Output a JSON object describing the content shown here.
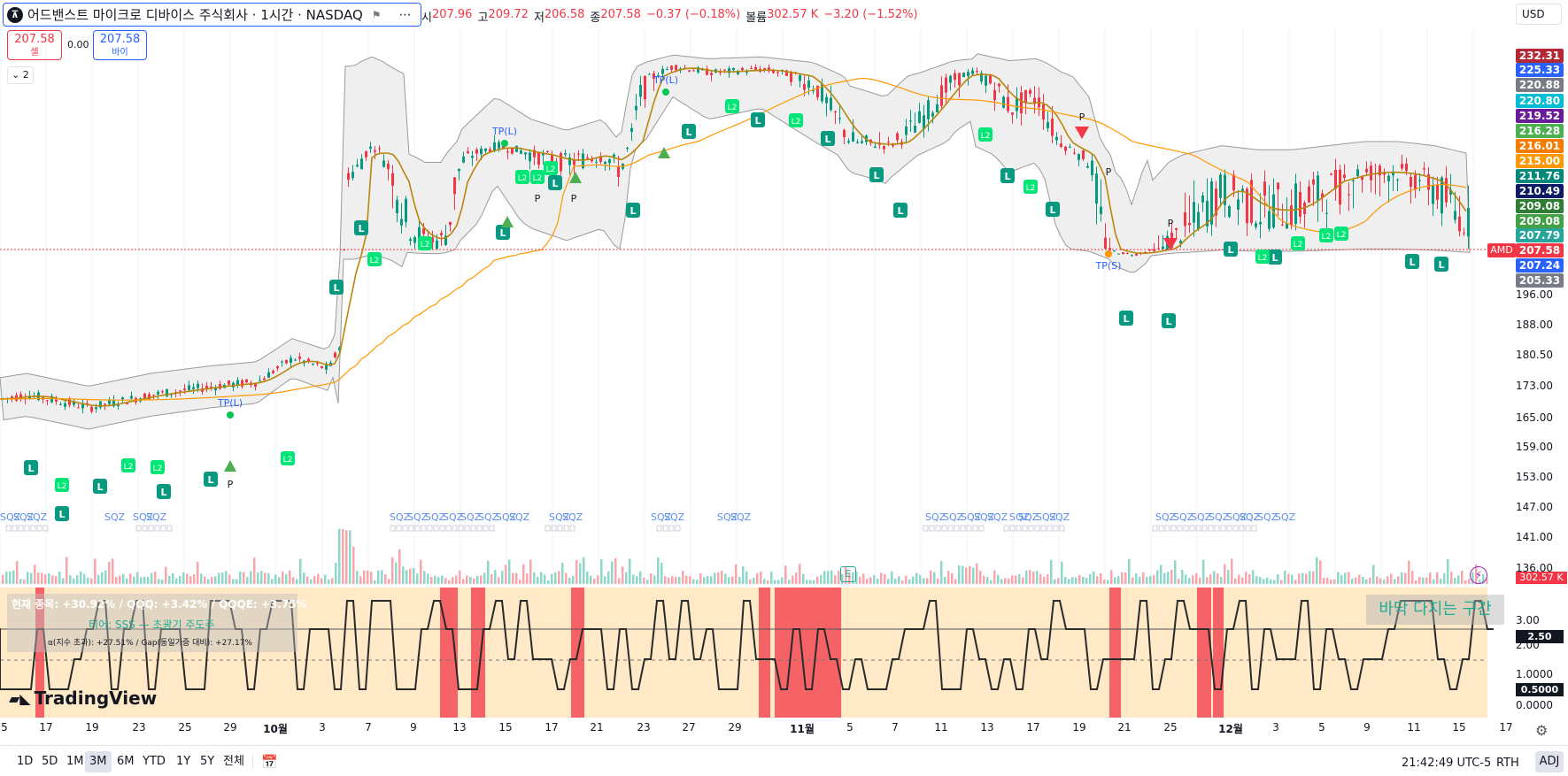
{
  "header": {
    "title": "어드밴스트 마이크로 디바이스 주식회사 · 1시간 · NASDAQ",
    "ohlc": [
      {
        "label": "시",
        "value": "207.96"
      },
      {
        "label": "고",
        "value": "209.72"
      },
      {
        "label": "저",
        "value": "206.58"
      },
      {
        "label": "종",
        "value": "207.58"
      },
      {
        "label": "",
        "value": "−0.37 (−0.18%)"
      },
      {
        "label": "볼륨",
        "value": "302.57 K"
      },
      {
        "label": "",
        "value": "−3.20 (−1.52%)"
      }
    ]
  },
  "trade": {
    "sell_price": "207.58",
    "sell_label": "셀",
    "spread": "0.00",
    "buy_price": "207.58",
    "buy_label": "바이",
    "indicator_count": "2"
  },
  "currency": "USD",
  "symbol_tag": "AMD",
  "price_tags": [
    {
      "value": "232.31",
      "color": "#b22833"
    },
    {
      "value": "225.33",
      "color": "#2962ff"
    },
    {
      "value": "220.88",
      "color": "#787b86"
    },
    {
      "value": "220.80",
      "color": "#00bcd4"
    },
    {
      "value": "219.52",
      "color": "#6a1b9a"
    },
    {
      "value": "216.28",
      "color": "#4caf50"
    },
    {
      "value": "216.01",
      "color": "#f57c00"
    },
    {
      "value": "215.00",
      "color": "#ff9800"
    },
    {
      "value": "211.76",
      "color": "#00897b"
    },
    {
      "value": "210.49",
      "color": "#0d1a66"
    },
    {
      "value": "209.08",
      "color": "#2e7d32"
    },
    {
      "value": "209.08",
      "color": "#43a047"
    },
    {
      "value": "207.79",
      "color": "#26a69a"
    },
    {
      "value": "207.58",
      "color": "#f23645"
    },
    {
      "value": "207.24",
      "color": "#2962ff"
    },
    {
      "value": "205.33",
      "color": "#787b86"
    }
  ],
  "price_axis": [
    "196.00",
    "188.00",
    "180.50",
    "173.00",
    "165.00",
    "159.00",
    "153.00",
    "147.00",
    "141.00",
    "136.00"
  ],
  "volume_tag": "302.57 K",
  "osc_axis": [
    "3.00",
    "2.00",
    "1.0000",
    "0.0000"
  ],
  "osc_tags": [
    "2.50",
    "0.5000"
  ],
  "info_panel": {
    "line1": "현재 종목: +30.92% / QQQ: +3.42% / QQQE: +3.75%",
    "line2": "티어: SSS — 초광기 주도주",
    "line3": "α(지수 초과): +27.51% / Gap(동일가중 대비): +27.17%"
  },
  "zone_label": "바닥 다지는 구간",
  "markers": {
    "sqz": "SQZ",
    "tp_long": "TP(L)",
    "tp_short": "TP(S)",
    "p": "P",
    "l": "L",
    "l2": "L2"
  },
  "date_axis": [
    "5",
    "17",
    "19",
    "23",
    "25",
    "29",
    "10월",
    "3",
    "7",
    "9",
    "13",
    "15",
    "17",
    "21",
    "23",
    "27",
    "29",
    "11월",
    "5",
    "7",
    "11",
    "13",
    "17",
    "19",
    "21",
    "25",
    "12월",
    "3",
    "5",
    "9",
    "11",
    "15",
    "17"
  ],
  "range_buttons": [
    "1D",
    "5D",
    "1M",
    "3M",
    "6M",
    "YTD",
    "1Y",
    "5Y",
    "전체"
  ],
  "active_range": "3M",
  "clock": "21:42:49 UTC-5",
  "rth": "RTH",
  "adj": "ADJ",
  "brand": "TradingView",
  "icons": [
    "search-icon",
    "flag-icon",
    "more-icon",
    "gear-icon",
    "calendar-icon",
    "bolt-icon",
    "earnings-icon",
    "chevron-down-icon"
  ],
  "chart_data": {
    "type": "candlestick",
    "y_range": [
      136,
      232
    ],
    "anchors": [
      [
        0,
        159
      ],
      [
        30,
        160
      ],
      [
        100,
        157
      ],
      [
        170,
        160
      ],
      [
        240,
        162
      ],
      [
        290,
        163
      ],
      [
        330,
        169
      ],
      [
        370,
        166
      ],
      [
        382,
        172
      ],
      [
        388,
        210
      ],
      [
        400,
        210
      ],
      [
        420,
        214
      ],
      [
        440,
        210
      ],
      [
        460,
        207
      ],
      [
        480,
        206
      ],
      [
        500,
        206
      ],
      [
        520,
        211
      ],
      [
        560,
        214
      ],
      [
        600,
        212
      ],
      [
        640,
        211
      ],
      [
        680,
        212
      ],
      [
        700,
        210
      ],
      [
        720,
        219
      ],
      [
        760,
        224
      ],
      [
        800,
        222
      ],
      [
        860,
        223
      ],
      [
        920,
        220
      ],
      [
        960,
        215
      ],
      [
        1000,
        214
      ],
      [
        1040,
        217
      ],
      [
        1080,
        221
      ],
      [
        1100,
        222
      ],
      [
        1140,
        218
      ],
      [
        1170,
        219
      ],
      [
        1200,
        214
      ],
      [
        1230,
        211
      ],
      [
        1260,
        202
      ],
      [
        1280,
        200
      ],
      [
        1300,
        204
      ],
      [
        1320,
        206
      ],
      [
        1340,
        207
      ],
      [
        1380,
        209
      ],
      [
        1420,
        208
      ],
      [
        1460,
        208
      ],
      [
        1500,
        209
      ],
      [
        1540,
        210
      ],
      [
        1580,
        210
      ],
      [
        1620,
        209
      ],
      [
        1660,
        207
      ]
    ]
  }
}
